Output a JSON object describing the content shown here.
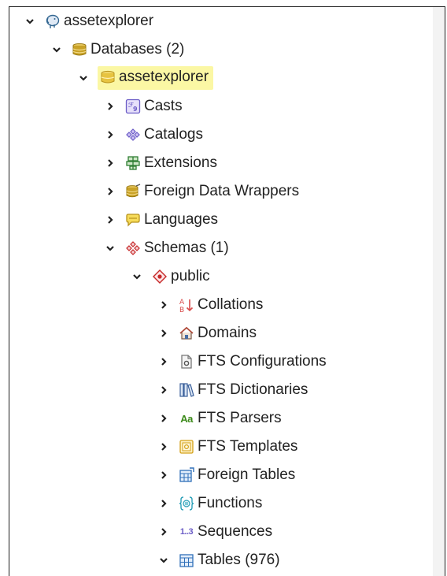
{
  "tree": {
    "server": {
      "label": "assetexplorer",
      "icon": "postgres-elephant-icon"
    },
    "databases": {
      "label": "Databases (2)",
      "icon": "database-stack-icon"
    },
    "database": {
      "label": "assetexplorer",
      "icon": "database-icon",
      "highlight": "#fbf7a4"
    },
    "casts": {
      "label": "Casts",
      "icon": "casts-icon"
    },
    "catalogs": {
      "label": "Catalogs",
      "icon": "catalogs-icon"
    },
    "extensions": {
      "label": "Extensions",
      "icon": "extensions-icon"
    },
    "fdw": {
      "label": "Foreign Data Wrappers",
      "icon": "foreign-data-wrappers-icon"
    },
    "languages": {
      "label": "Languages",
      "icon": "languages-icon"
    },
    "schemas": {
      "label": "Schemas (1)",
      "icon": "schemas-icon"
    },
    "public": {
      "label": "public",
      "icon": "schema-diamond-icon"
    },
    "collations": {
      "label": "Collations",
      "icon": "collations-icon",
      "glyph_top": "A",
      "glyph_bottom": "B"
    },
    "domains": {
      "label": "Domains",
      "icon": "domains-house-icon"
    },
    "fts_config": {
      "label": "FTS Configurations",
      "icon": "fts-configurations-icon"
    },
    "fts_dict": {
      "label": "FTS Dictionaries",
      "icon": "fts-dictionaries-icon"
    },
    "fts_parsers": {
      "label": "FTS Parsers",
      "icon": "fts-parsers-icon",
      "glyph": "Aa"
    },
    "fts_templates": {
      "label": "FTS Templates",
      "icon": "fts-templates-icon"
    },
    "foreign_tables": {
      "label": "Foreign Tables",
      "icon": "foreign-tables-icon"
    },
    "functions": {
      "label": "Functions",
      "icon": "functions-icon"
    },
    "sequences": {
      "label": "Sequences",
      "icon": "sequences-icon",
      "glyph": "1..3"
    },
    "tables": {
      "label": "Tables (976)",
      "icon": "tables-icon"
    }
  },
  "colors": {
    "database_gold": "#c9a227",
    "highlight": "#fbf7a4",
    "text": "#222222"
  }
}
